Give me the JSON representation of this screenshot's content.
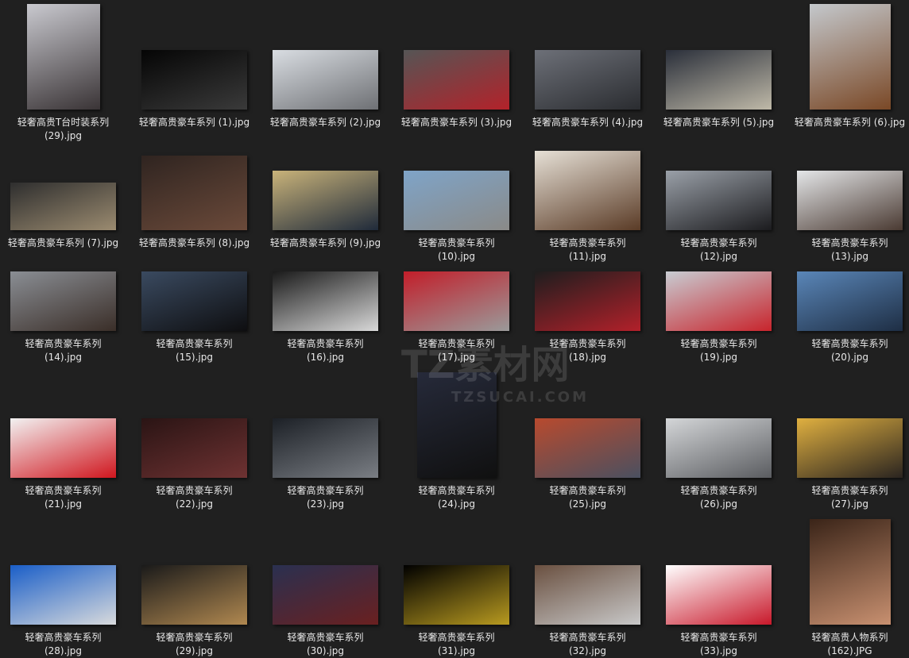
{
  "watermark": {
    "brand": "TZ素材网",
    "url": "TZSUCAI.COM"
  },
  "rows": [
    {
      "items": [
        {
          "name": "轻奢高贵T台时装系列",
          "ext": "(29).jpg",
          "shape": "portrait",
          "c1": "#c9c9cf",
          "c2": "#3a3436"
        },
        {
          "name": "轻奢高贵豪车系列  (1).jpg",
          "ext": "",
          "shape": "landscape",
          "c1": "#050505",
          "c2": "#3a3a3a"
        },
        {
          "name": "轻奢高贵豪车系列  (2).jpg",
          "ext": "",
          "shape": "landscape",
          "c1": "#d9dde2",
          "c2": "#6e7074"
        },
        {
          "name": "轻奢高贵豪车系列  (3).jpg",
          "ext": "",
          "shape": "landscape",
          "c1": "#555555",
          "c2": "#b3222a"
        },
        {
          "name": "轻奢高贵豪车系列  (4).jpg",
          "ext": "",
          "shape": "landscape",
          "c1": "#6d7078",
          "c2": "#2a2c30"
        },
        {
          "name": "轻奢高贵豪车系列  (5).jpg",
          "ext": "",
          "shape": "landscape",
          "c1": "#2a2f3a",
          "c2": "#bfb9a8"
        },
        {
          "name": "轻奢高贵豪车系列  (6).jpg",
          "ext": "",
          "shape": "portrait",
          "c1": "#c4c8cc",
          "c2": "#7a4826"
        }
      ]
    },
    {
      "items": [
        {
          "name": "轻奢高贵豪车系列  (7).jpg",
          "ext": "",
          "shape": "wide",
          "c1": "#2e2e2e",
          "c2": "#9b8b70"
        },
        {
          "name": "轻奢高贵豪车系列  (8).jpg",
          "ext": "",
          "shape": "mid",
          "c1": "#2f2420",
          "c2": "#6b4a3a"
        },
        {
          "name": "轻奢高贵豪车系列  (9).jpg",
          "ext": "",
          "shape": "landscape",
          "c1": "#c9b37a",
          "c2": "#1f2a3a"
        },
        {
          "name": "轻奢高贵豪车系列",
          "ext": "(10).jpg",
          "shape": "landscape",
          "c1": "#7fa4c8",
          "c2": "#8a8a88"
        },
        {
          "name": "轻奢高贵豪车系列",
          "ext": "(11).jpg",
          "shape": "tall",
          "c1": "#e6e0d6",
          "c2": "#5a3b26"
        },
        {
          "name": "轻奢高贵豪车系列",
          "ext": "(12).jpg",
          "shape": "landscape",
          "c1": "#9aa0a8",
          "c2": "#1b1b1e"
        },
        {
          "name": "轻奢高贵豪车系列",
          "ext": "(13).jpg",
          "shape": "landscape",
          "c1": "#e4e6e8",
          "c2": "#4a3a32"
        }
      ]
    },
    {
      "items": [
        {
          "name": "轻奢高贵豪车系列",
          "ext": "(14).jpg",
          "shape": "landscape",
          "c1": "#8a8e94",
          "c2": "#3a2e28"
        },
        {
          "name": "轻奢高贵豪车系列",
          "ext": "(15).jpg",
          "shape": "landscape",
          "c1": "#3a4a60",
          "c2": "#0e0e10"
        },
        {
          "name": "轻奢高贵豪车系列",
          "ext": "(16).jpg",
          "shape": "landscape",
          "c1": "#1a1a1a",
          "c2": "#d8d8d8"
        },
        {
          "name": "轻奢高贵豪车系列",
          "ext": "(17).jpg",
          "shape": "landscape",
          "c1": "#c21e2a",
          "c2": "#9a9a9a"
        },
        {
          "name": "轻奢高贵豪车系列",
          "ext": "(18).jpg",
          "shape": "landscape",
          "c1": "#1e1e1e",
          "c2": "#b2202a"
        },
        {
          "name": "轻奢高贵豪车系列",
          "ext": "(19).jpg",
          "shape": "landscape",
          "c1": "#c8ccd2",
          "c2": "#c8242c"
        },
        {
          "name": "轻奢高贵豪车系列",
          "ext": "(20).jpg",
          "shape": "landscape",
          "c1": "#5a86b8",
          "c2": "#1e2e44"
        }
      ]
    },
    {
      "items": [
        {
          "name": "轻奢高贵豪车系列",
          "ext": "(21).jpg",
          "shape": "landscape",
          "c1": "#f2f2f2",
          "c2": "#d0161e"
        },
        {
          "name": "轻奢高贵豪车系列",
          "ext": "(22).jpg",
          "shape": "landscape",
          "c1": "#2a1414",
          "c2": "#6e3232"
        },
        {
          "name": "轻奢高贵豪车系列",
          "ext": "(23).jpg",
          "shape": "landscape",
          "c1": "#1c2026",
          "c2": "#7a7e84"
        },
        {
          "name": "轻奢高贵豪车系列",
          "ext": "(24).jpg",
          "shape": "portrait",
          "c1": "#262a3a",
          "c2": "#101010"
        },
        {
          "name": "轻奢高贵豪车系列",
          "ext": "(25).jpg",
          "shape": "landscape",
          "c1": "#b84a2e",
          "c2": "#4a5060"
        },
        {
          "name": "轻奢高贵豪车系列",
          "ext": "(26).jpg",
          "shape": "landscape",
          "c1": "#d4d6d8",
          "c2": "#5a5c60"
        },
        {
          "name": "轻奢高贵豪车系列",
          "ext": "(27).jpg",
          "shape": "landscape",
          "c1": "#e0b040",
          "c2": "#2a2420"
        }
      ]
    },
    {
      "items": [
        {
          "name": "轻奢高贵豪车系列",
          "ext": "(28).jpg",
          "shape": "landscape",
          "c1": "#1a5ec8",
          "c2": "#d8dadc"
        },
        {
          "name": "轻奢高贵豪车系列",
          "ext": "(29).jpg",
          "shape": "landscape",
          "c1": "#1a1a1a",
          "c2": "#b08850"
        },
        {
          "name": "轻奢高贵豪车系列",
          "ext": "(30).jpg",
          "shape": "landscape",
          "c1": "#2a3050",
          "c2": "#6a2020"
        },
        {
          "name": "轻奢高贵豪车系列",
          "ext": "(31).jpg",
          "shape": "landscape",
          "c1": "#000000",
          "c2": "#b89a20"
        },
        {
          "name": "轻奢高贵豪车系列",
          "ext": "(32).jpg",
          "shape": "landscape",
          "c1": "#6a5040",
          "c2": "#c8c8c8"
        },
        {
          "name": "轻奢高贵豪车系列",
          "ext": "(33).jpg",
          "shape": "landscape",
          "c1": "#ffffff",
          "c2": "#c8182a"
        },
        {
          "name": "轻奢高贵人物系列",
          "ext": "(162).JPG",
          "shape": "portrait",
          "c1": "#3a2418",
          "c2": "#c89070"
        }
      ]
    }
  ]
}
